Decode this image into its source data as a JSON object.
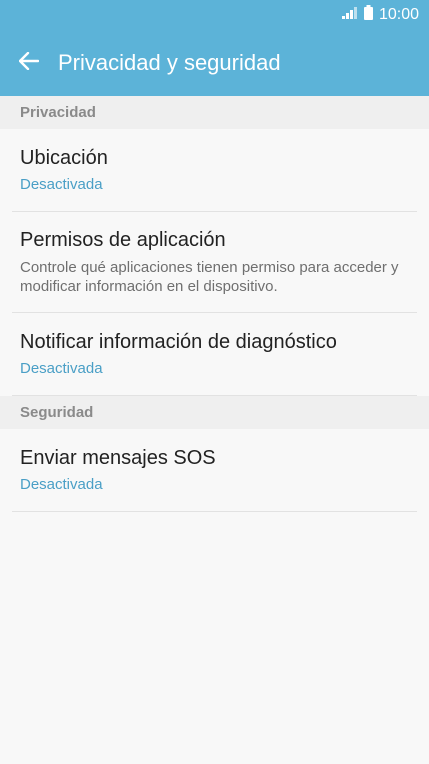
{
  "status_bar": {
    "time": "10:00"
  },
  "app_bar": {
    "title": "Privacidad y seguridad"
  },
  "sections": [
    {
      "header": "Privacidad",
      "items": [
        {
          "title": "Ubicación",
          "subtitle": "Desactivada"
        },
        {
          "title": "Permisos de aplicación",
          "description": "Controle qué aplicaciones tienen permiso para acceder y modificar información en el dispositivo."
        },
        {
          "title": "Notificar información de diagnóstico",
          "subtitle": "Desactivada"
        }
      ]
    },
    {
      "header": "Seguridad",
      "items": [
        {
          "title": "Enviar mensajes SOS",
          "subtitle": "Desactivada"
        }
      ]
    }
  ],
  "colors": {
    "accent": "#5cb3d8",
    "subtitle": "#4a9fc6",
    "section_bg": "#efefef"
  },
  "icons": {
    "back": "back-arrow-icon",
    "signal": "signal-icon",
    "battery": "battery-icon"
  }
}
